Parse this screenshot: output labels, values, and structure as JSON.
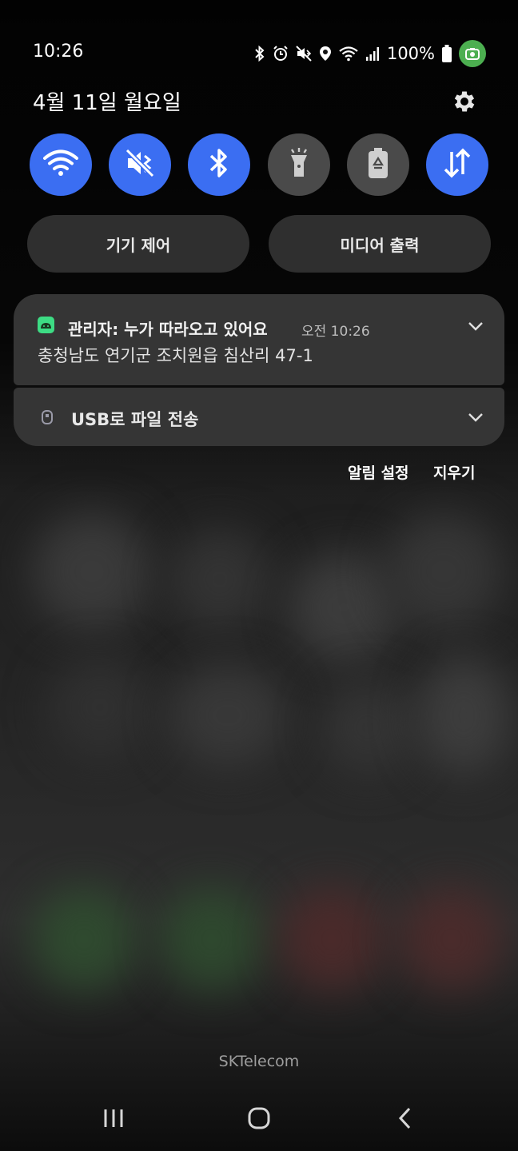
{
  "status_bar": {
    "time": "10:26",
    "battery_percent": "100%",
    "icons": [
      "bluetooth-icon",
      "alarm-icon",
      "mute-icon",
      "location-icon",
      "wifi-icon",
      "signal-icon",
      "battery-icon",
      "screen-recorder-icon"
    ]
  },
  "header": {
    "date": "4월 11일 월요일",
    "settings_icon": "gear-icon"
  },
  "quick_toggles": [
    {
      "name": "wifi",
      "icon": "wifi-icon",
      "state": "on"
    },
    {
      "name": "sound",
      "icon": "mute-icon",
      "state": "on"
    },
    {
      "name": "bluetooth",
      "icon": "bluetooth-icon",
      "state": "on"
    },
    {
      "name": "flashlight",
      "icon": "flashlight-icon",
      "state": "off"
    },
    {
      "name": "power-saving",
      "icon": "battery-saver-icon",
      "state": "off"
    },
    {
      "name": "mobile-data",
      "icon": "data-arrows-icon",
      "state": "on"
    }
  ],
  "buttons": {
    "device_control": "기기 제어",
    "media_output": "미디어 출력"
  },
  "notifications": [
    {
      "app_icon": "android-icon",
      "title": "관리자: 누가 따라오고 있어요",
      "time": "오전 10:26",
      "body": "충청남도 연기군 조치원읍 침산리 47-1"
    },
    {
      "app_icon": "usb-icon",
      "title": "USB로 파일 전송"
    }
  ],
  "actions": {
    "notification_settings": "알림 설정",
    "clear": "지우기"
  },
  "carrier": "SKTelecom",
  "navigation": [
    "recent-apps-icon",
    "home-icon",
    "back-icon"
  ],
  "colors": {
    "toggle_on": "#3b6ef2",
    "toggle_off": "#4a4a4a",
    "card": "#353535",
    "pill": "#2f2f2f",
    "recorder_badge": "#4caf50",
    "android_green": "#3ddc84"
  }
}
